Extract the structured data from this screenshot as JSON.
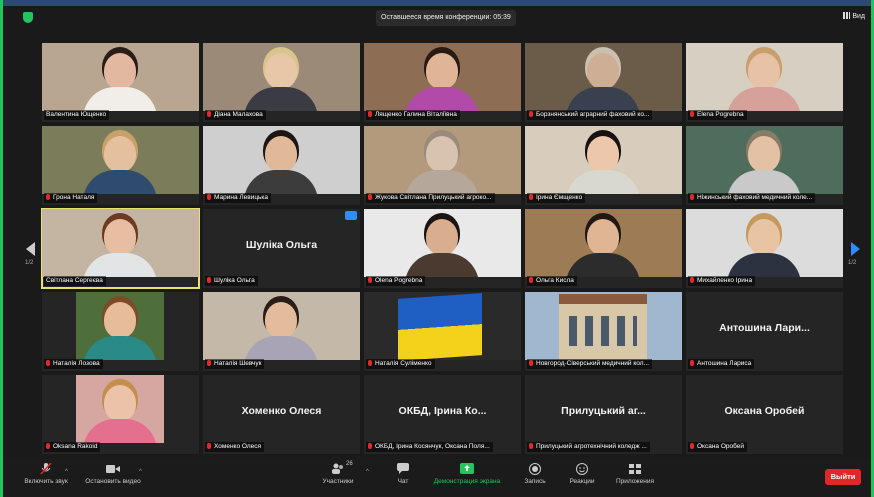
{
  "topbar": {
    "timer": "Оставшееся время конференции: 05:39",
    "view_label": "Вид"
  },
  "tiles": [
    {
      "label": "Валентина Ющенко",
      "muted": false,
      "bg": "#b9a690",
      "skin": "#e2b9a0",
      "shirt": "#f1ede8",
      "hair": "#2a1c16"
    },
    {
      "label": "Діана Малахова",
      "muted": true,
      "bg": "#9b8a78",
      "skin": "#e8c7a8",
      "shirt": "#3b3b44",
      "hair": "#d9c48e"
    },
    {
      "label": "Лященко Галина Віталіївна",
      "muted": true,
      "bg": "#8d6e55",
      "skin": "#dfb596",
      "shirt": "#b14aa9",
      "hair": "#2a1a14"
    },
    {
      "label": "Борзнянський аграрний фаховий ко...",
      "muted": true,
      "bg": "#6b5c4a",
      "skin": "#cfae96",
      "shirt": "#394050",
      "hair": "#c9c0b0"
    },
    {
      "label": "Elena Pogrebna",
      "muted": true,
      "bg": "#d8cfc3",
      "skin": "#e8c2a6",
      "shirt": "#d5a19a",
      "hair": "#c79e6c"
    },
    {
      "label": "Грона Наталя",
      "muted": true,
      "bg": "#7a7c5a",
      "skin": "#e4c09e",
      "shirt": "#2f4b6d",
      "hair": "#c8a06a"
    },
    {
      "label": "Марина Левицька",
      "muted": true,
      "bg": "#cfcfcf",
      "skin": "#e2b998",
      "shirt": "#3c3c3c",
      "hair": "#1c1612"
    },
    {
      "label": "Жукова Світлана Прилуцький агроко...",
      "muted": true,
      "bg": "#b49a7c",
      "skin": "#d8c2b0",
      "shirt": "#b5a89a",
      "hair": "#9a8a7c"
    },
    {
      "label": "Ірина Ємщенко",
      "muted": true,
      "bg": "#d8cdbd",
      "skin": "#ecc7ab",
      "shirt": "#d8d8d0",
      "hair": "#17120f"
    },
    {
      "label": "Ніжинський фаховий медичний коле...",
      "muted": true,
      "bg": "#4f6d5c",
      "skin": "#e3c1a5",
      "shirt": "#c9c9c9",
      "hair": "#8a7b66"
    },
    {
      "label": "Світлана Сергеєва",
      "muted": false,
      "bg": "#c4b4a2",
      "skin": "#e7bea2",
      "shirt": "#e2e4e6",
      "hair": "#6e3a22",
      "highlight": true
    },
    {
      "label": "Шуліка Ольга",
      "muted": true,
      "name_card": "Шуліка Ольга"
    },
    {
      "label": "Olena Pogrebna",
      "muted": true,
      "bg": "#e9e9e9",
      "skin": "#d9ae8e",
      "shirt": "#4a3a30",
      "hair": "#1a1412"
    },
    {
      "label": "Ольга Кисла",
      "muted": true,
      "bg": "#9c7b55",
      "skin": "#e0b593",
      "shirt": "#2c2c2c",
      "hair": "#221812"
    },
    {
      "label": "Михайленко Ірина",
      "muted": true,
      "bg": "#dcdcdc",
      "skin": "#e8c4a4",
      "shirt": "#2d3240",
      "hair": "#c49a5c"
    },
    {
      "label": "Наталія Лозова",
      "muted": true,
      "bg": "#4e6e3c",
      "skin": "#e6bc9a",
      "shirt": "#2a8a87",
      "hair": "#7b4b2a",
      "inset": true
    },
    {
      "label": "Наталія Шевчук",
      "muted": true,
      "bg": "#c4b9a8",
      "skin": "#e3bb9d",
      "shirt": "#a9a3b6",
      "hair": "#2a1c16"
    },
    {
      "label": "Наталія Суліменко",
      "muted": true,
      "flag": true
    },
    {
      "label": "Новгород-Сіверський медичний кол...",
      "muted": true,
      "building": true
    },
    {
      "label": "Антошина Лариса",
      "muted": true,
      "name_card": "Антошина Лари..."
    },
    {
      "label": "Oksana Rakoid",
      "muted": true,
      "bg": "#d6a7a0",
      "skin": "#ecc3a8",
      "shirt": "#e56f8f",
      "hair": "#c58e4d",
      "inset": true
    },
    {
      "label": "Хоменко Олеся",
      "muted": true,
      "name_card": "Хоменко Олеся"
    },
    {
      "label": "ОКБД, Ірина Косянчук, Оксана Поля...",
      "muted": true,
      "name_card": "ОКБД, Ірина Ко..."
    },
    {
      "label": "Прилуцький агротехнічний коледж ...",
      "muted": true,
      "name_card": "Прилуцький аг..."
    },
    {
      "label": "Оксана Оробей",
      "muted": true,
      "name_card": "Оксана Оробей"
    }
  ],
  "nav": {
    "left_page": "1/2",
    "right_page": "1/2"
  },
  "toolbar": {
    "mute": "Включить звук",
    "video": "Остановить видео",
    "participants": "Участники",
    "participants_count": "26",
    "chat": "Чат",
    "share": "Демонстрация экрана",
    "record": "Запись",
    "reactions": "Реакции",
    "apps": "Приложения",
    "end": "Выйти"
  },
  "colors": {
    "accent_green": "#21c55d",
    "share_green": "#22c55e",
    "end_red": "#e02828",
    "muted_red": "#e0292a",
    "speaker_yellow": "#e7e36a"
  }
}
